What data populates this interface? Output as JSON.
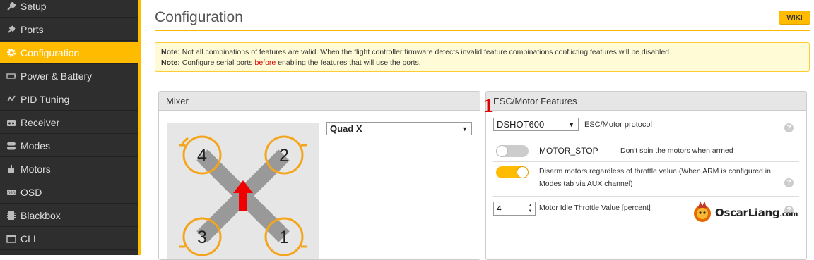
{
  "sidebar": {
    "items": [
      {
        "label": "Setup",
        "icon": "wrench-icon"
      },
      {
        "label": "Ports",
        "icon": "plug-icon"
      },
      {
        "label": "Configuration",
        "icon": "gear-icon",
        "active": true
      },
      {
        "label": "Power & Battery",
        "icon": "battery-icon"
      },
      {
        "label": "PID Tuning",
        "icon": "sliders-icon"
      },
      {
        "label": "Receiver",
        "icon": "receiver-icon"
      },
      {
        "label": "Modes",
        "icon": "toggles-icon"
      },
      {
        "label": "Motors",
        "icon": "motor-icon"
      },
      {
        "label": "OSD",
        "icon": "osd-icon"
      },
      {
        "label": "Blackbox",
        "icon": "blackbox-icon"
      },
      {
        "label": "CLI",
        "icon": "terminal-icon"
      }
    ],
    "accent_color": "#ffbb00"
  },
  "header": {
    "title": "Configuration",
    "wiki_label": "WIKI"
  },
  "note": {
    "line1_prefix": "Note:",
    "line1_text": " Not all combinations of features are valid. When the flight controller firmware detects invalid feature combinations conflicting features will be disabled.",
    "line2_prefix": "Note:",
    "line2_text_a": " Configure serial ports ",
    "line2_highlight": "before",
    "line2_text_b": " enabling the features that will use the ports."
  },
  "mixer": {
    "title": "Mixer",
    "selected": "Quad X",
    "motors": [
      "4",
      "2",
      "3",
      "1"
    ]
  },
  "esc": {
    "title": "ESC/Motor Features",
    "protocol_value": "DSHOT600",
    "protocol_label": "ESC/Motor protocol",
    "motor_stop_label": "MOTOR_STOP",
    "motor_stop_desc": "Don't spin the motors when armed",
    "motor_stop_on": false,
    "disarm_desc_1": "Disarm motors regardless of throttle value (When ARM is configured in",
    "disarm_desc_2": "Modes tab via AUX channel)",
    "disarm_on": true,
    "idle_value": "4",
    "idle_label": "Motor Idle Throttle Value [percent]",
    "help_glyph": "?"
  },
  "annotation": {
    "number": "1"
  },
  "watermark": {
    "text": "OscarLiang",
    "suffix": ".com"
  }
}
